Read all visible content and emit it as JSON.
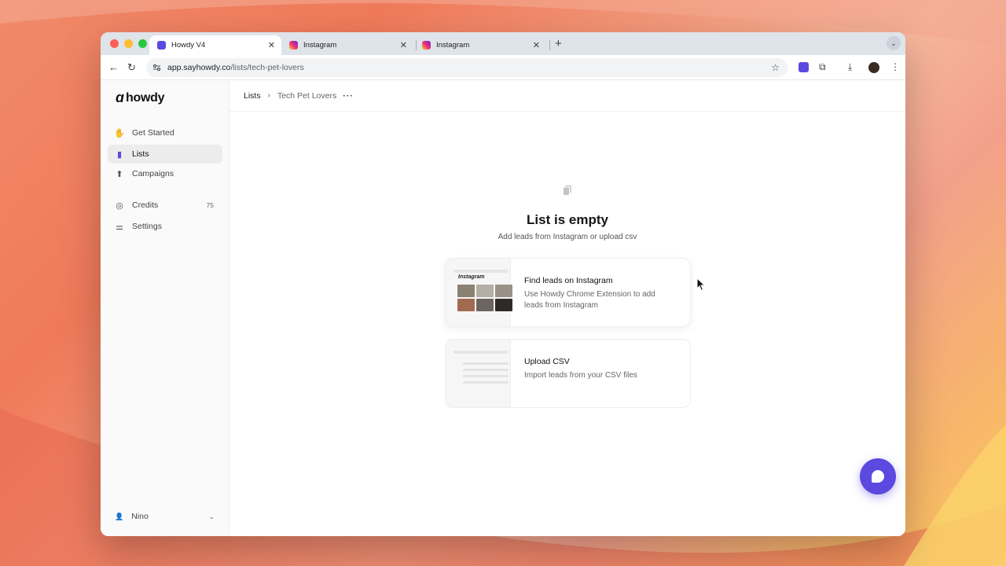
{
  "browser": {
    "tabs": [
      {
        "label": "Howdy V4",
        "active": true,
        "favicon": "howdy-favicon",
        "color": "#5b49e0"
      },
      {
        "label": "Instagram",
        "active": false,
        "favicon": "instagram-favicon",
        "color": "#e1306c"
      },
      {
        "label": "Instagram",
        "active": false,
        "favicon": "instagram-favicon",
        "color": "#e1306c"
      }
    ],
    "url_host": "app.sayhowdy.co",
    "url_path": "/lists/tech-pet-lovers"
  },
  "sidebar": {
    "logo": "howdy",
    "items": [
      {
        "label": "Get Started",
        "icon": "wave-hand-icon",
        "active": false
      },
      {
        "label": "Lists",
        "icon": "lists-icon",
        "active": true
      },
      {
        "label": "Campaigns",
        "icon": "campaigns-icon",
        "active": false
      },
      {
        "label": "Credits",
        "icon": "coins-icon",
        "count": "75",
        "active": false
      },
      {
        "label": "Settings",
        "icon": "sliders-icon",
        "active": false
      }
    ],
    "user": "Nino"
  },
  "breadcrumb": {
    "root": "Lists",
    "current": "Tech Pet Lovers",
    "more": "···"
  },
  "empty_state": {
    "title": "List is empty",
    "subtitle": "Add leads from Instagram or upload csv"
  },
  "cards": [
    {
      "title": "Find leads on Instagram",
      "description": "Use Howdy Chrome Extension to add leads from Instagram",
      "thumb_label": "Instagram"
    },
    {
      "title": "Upload CSV",
      "description": "Import leads from your CSV files"
    }
  ],
  "colors": {
    "accent": "#5b49e0"
  }
}
